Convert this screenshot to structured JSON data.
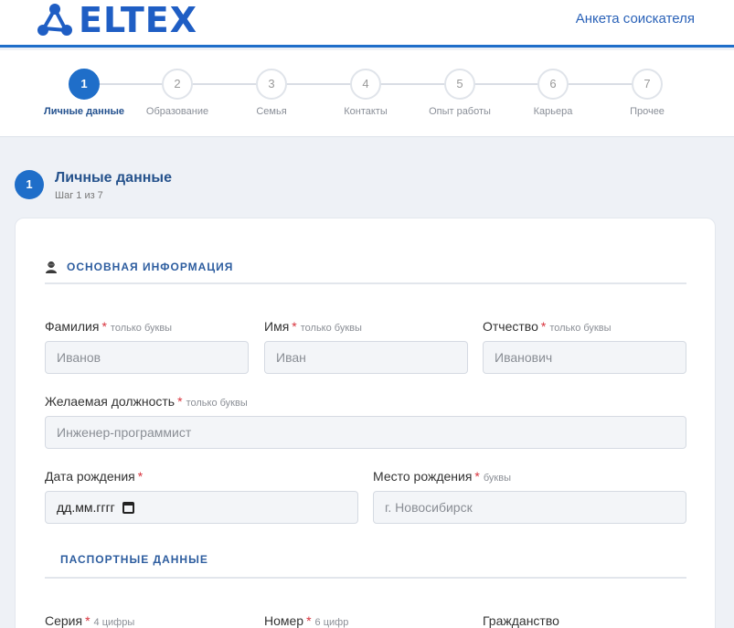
{
  "header": {
    "logo_text": "ELTEX",
    "link_label": "Анкета соискателя"
  },
  "steps": [
    {
      "num": "1",
      "label": "Личные данные",
      "active": true
    },
    {
      "num": "2",
      "label": "Образование"
    },
    {
      "num": "3",
      "label": "Семья"
    },
    {
      "num": "4",
      "label": "Контакты"
    },
    {
      "num": "5",
      "label": "Опыт работы"
    },
    {
      "num": "6",
      "label": "Карьера"
    },
    {
      "num": "7",
      "label": "Прочее"
    }
  ],
  "section": {
    "num": "1",
    "title": "Личные данные",
    "subtitle": "Шаг 1 из 7"
  },
  "groups": {
    "basic": "Основная информация",
    "passport": "Паспортные данные"
  },
  "fields": {
    "last_name": {
      "label": "Фамилия",
      "req": "*",
      "hint": "только буквы",
      "placeholder": "Иванов"
    },
    "first_name": {
      "label": "Имя",
      "req": "*",
      "hint": "только буквы",
      "placeholder": "Иван"
    },
    "patronymic": {
      "label": "Отчество",
      "req": "*",
      "hint": "только буквы",
      "placeholder": "Иванович"
    },
    "position": {
      "label": "Желаемая должность",
      "req": "*",
      "hint": "только буквы",
      "placeholder": "Инженер-программист"
    },
    "birth_date": {
      "label": "Дата рождения",
      "req": "*",
      "value": "дд.мм.гггг"
    },
    "birth_place": {
      "label": "Место рождения",
      "req": "*",
      "hint": "буквы",
      "placeholder": "г. Новосибирск"
    },
    "series": {
      "label": "Серия",
      "req": "*",
      "hint": "4 цифры"
    },
    "number": {
      "label": "Номер",
      "req": "*",
      "hint": "6 цифр"
    },
    "citizenship": {
      "label": "Гражданство"
    }
  }
}
